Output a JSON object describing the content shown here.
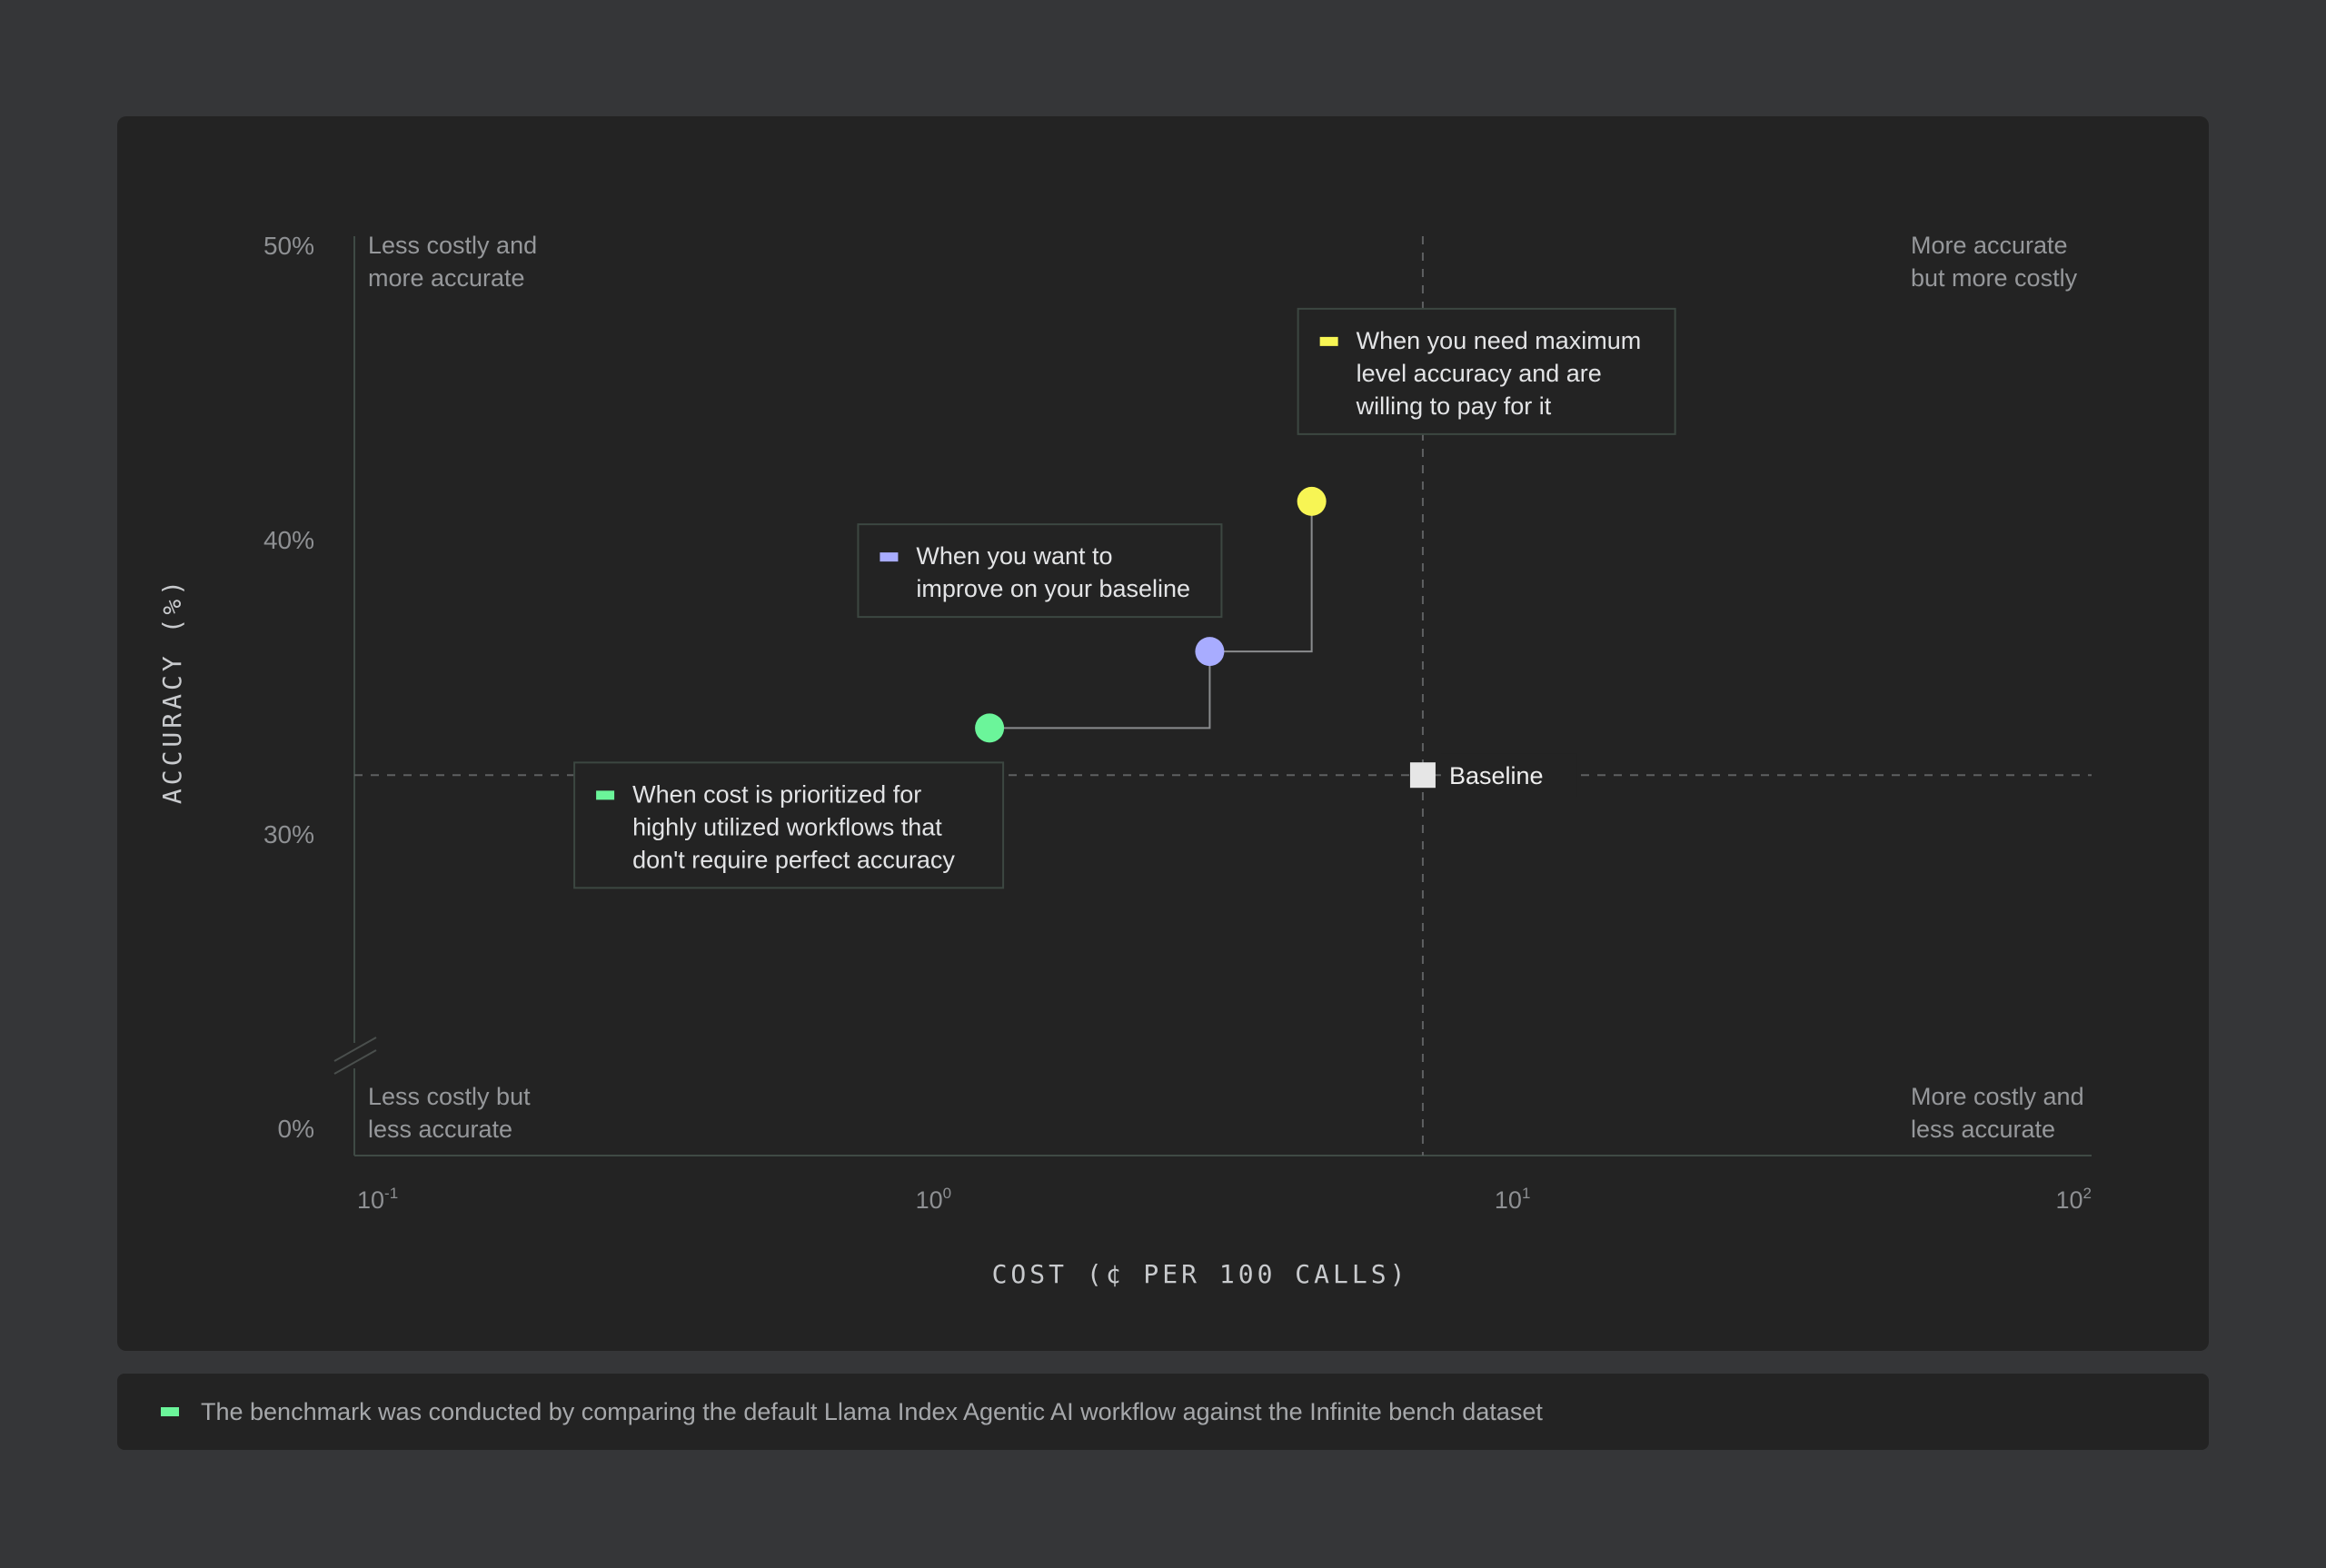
{
  "chart_data": {
    "type": "scatter",
    "x_scale": "log",
    "xlabel": "COST (¢ PER 100 CALLS)",
    "ylabel": "ACCURACY (%)",
    "xlim": [
      0.1,
      100
    ],
    "x_ticks": [
      {
        "base": "10",
        "exp": "-1",
        "value": 0.1
      },
      {
        "base": "10",
        "exp": "0",
        "value": 1
      },
      {
        "base": "10",
        "exp": "1",
        "value": 10
      },
      {
        "base": "10",
        "exp": "2",
        "value": 100
      }
    ],
    "y_ticks": [
      {
        "label": "50%",
        "value": 50
      },
      {
        "label": "40%",
        "value": 40
      },
      {
        "label": "30%",
        "value": 30
      },
      {
        "label": "0%",
        "value": 0
      }
    ],
    "y_axis_break": true,
    "grid": false,
    "quadrant_labels": {
      "top_left": [
        "Less costly and",
        "more accurate"
      ],
      "top_right": [
        "More accurate",
        "but more costly"
      ],
      "bottom_left": [
        "Less costly but",
        "less accurate"
      ],
      "bottom_right": [
        "More costly and",
        "less accurate"
      ]
    },
    "baseline": {
      "label": "Baseline",
      "x": 7.0,
      "y": 32.0,
      "color": "#e6e6e6"
    },
    "points": [
      {
        "x": 1.25,
        "y": 33.6,
        "color": "#6bf59a",
        "callout": [
          "When cost is prioritized for",
          "highly utilized workflows that",
          "don't require perfect accuracy"
        ]
      },
      {
        "x": 3.0,
        "y": 36.2,
        "color": "#a8acff",
        "callout": [
          "When you want to",
          "improve on your baseline"
        ]
      },
      {
        "x": 4.5,
        "y": 41.3,
        "color": "#f7f554",
        "callout": [
          "When you need maximum",
          "level accuracy and are",
          "willing to pay for it"
        ]
      }
    ]
  },
  "footer": {
    "marker_color": "#6bf59a",
    "text": "The benchmark was conducted by comparing the default Llama Index Agentic AI workflow against the Infinite bench dataset"
  }
}
